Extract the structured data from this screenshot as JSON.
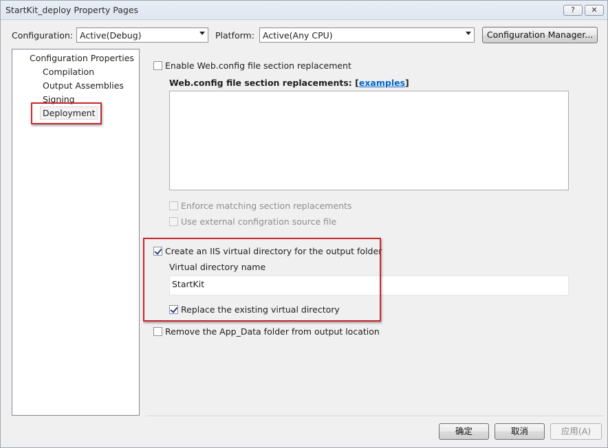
{
  "window": {
    "title": "StartKit_deploy Property Pages",
    "help_label": "?",
    "close_label": "✕"
  },
  "toolbar": {
    "configuration_label": "Configuration:",
    "configuration_value": "Active(Debug)",
    "platform_label": "Platform:",
    "platform_value": "Active(Any CPU)",
    "config_manager_label": "Configuration Manager..."
  },
  "tree": {
    "root": "Configuration Properties",
    "items": [
      {
        "label": "Compilation",
        "selected": false
      },
      {
        "label": "Output Assemblies",
        "selected": false
      },
      {
        "label": "Signing",
        "selected": false
      },
      {
        "label": "Deployment",
        "selected": true
      }
    ]
  },
  "deployment": {
    "enable_webconfig": {
      "label": "Enable Web.config file section replacement",
      "checked": false
    },
    "replacements_label": "Web.config file section replacements: [",
    "replacements_link": "examples",
    "replacements_close": "]",
    "replacements_text": "",
    "enforce_matching": {
      "label": "Enforce matching section replacements",
      "checked": false,
      "enabled": false
    },
    "use_external": {
      "label": "Use external configration source file",
      "checked": false,
      "enabled": false
    },
    "create_iis": {
      "label": "Create an IIS virtual directory for the output folder",
      "checked": true
    },
    "virtual_dir_label": "Virtual directory name",
    "virtual_dir_value": "StartKit",
    "replace_existing": {
      "label": "Replace the existing virtual directory",
      "checked": true
    },
    "remove_appdata": {
      "label": "Remove the App_Data folder from output location",
      "checked": false
    }
  },
  "footer": {
    "ok_label": "确定",
    "cancel_label": "取消",
    "apply_label": "应用(A)"
  },
  "colors": {
    "highlight_box": "#c8262b",
    "link": "#0066cc"
  }
}
